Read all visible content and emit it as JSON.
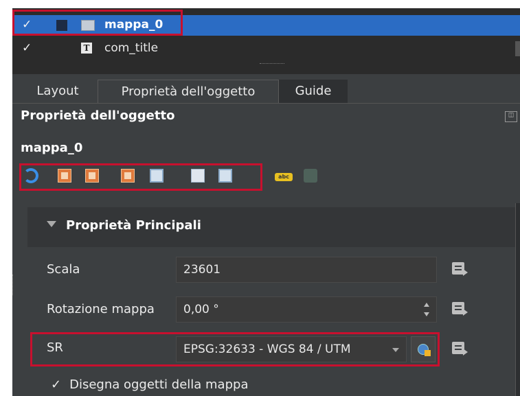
{
  "items": [
    {
      "checked": "✓",
      "name": "mappa_0",
      "selected": true
    },
    {
      "checked": "✓",
      "name": "com_title",
      "icon_text": "T",
      "selected": false
    }
  ],
  "tabs": [
    "Layout",
    "Proprietà dell'oggetto",
    "Guide"
  ],
  "panel_title": "Proprietà dell'oggetto",
  "object_name": "mappa_0",
  "toolbar_icons": [
    "refresh-icon",
    "set-extent-icon",
    "view-extent-icon",
    "set-scale-icon",
    "view-scale-icon",
    "bookmark-icon",
    "zoom-extent-icon",
    "label-abc-icon",
    "disabled-icon"
  ],
  "group": {
    "title": "Proprietà Principali"
  },
  "props": {
    "scale_label": "Scala",
    "scale_value": "23601",
    "rotation_label": "Rotazione mappa",
    "rotation_value": "0,00 °",
    "sr_label": "SR",
    "sr_value": "EPSG:32633 - WGS 84 / UTM"
  },
  "draw_items": {
    "check": "✓",
    "label": "Disegna oggetti della mappa"
  },
  "colors": {
    "highlight": "#c8102e",
    "selection": "#2b6cc4",
    "panel": "#3c3f41"
  }
}
